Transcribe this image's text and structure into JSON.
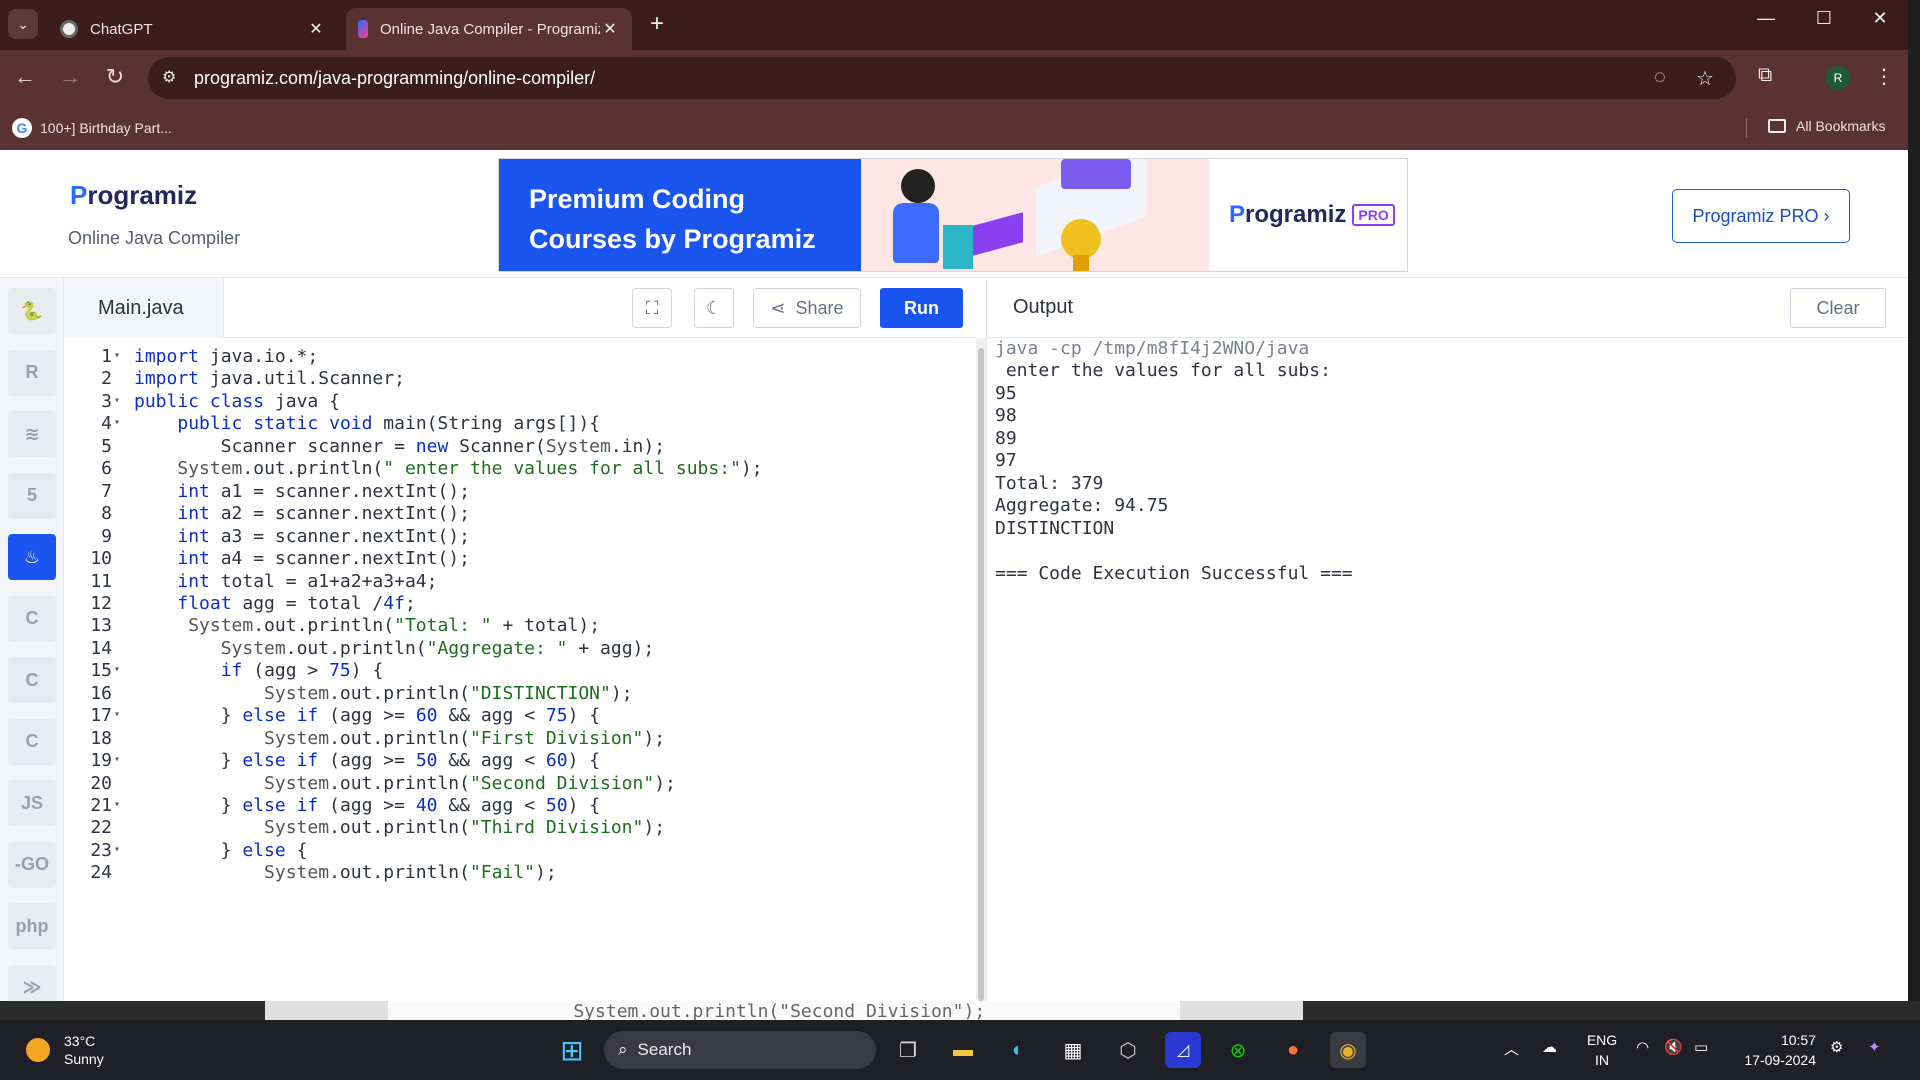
{
  "browser": {
    "tabs": [
      {
        "title": "ChatGPT",
        "active": false
      },
      {
        "title": "Online Java Compiler - Programiz",
        "active": true
      }
    ],
    "url": "programiz.com/java-programming/online-compiler/",
    "bookmarks": [
      {
        "label": "100+] Birthday Part..."
      }
    ],
    "all_bookmarks_label": "All Bookmarks",
    "profile_initial": "R"
  },
  "site": {
    "logo": "rogramiz",
    "logo_p": "P",
    "subtitle": "Online Java Compiler",
    "banner": {
      "headline_line1": "Premium Coding",
      "headline_line2": "Courses by Programiz",
      "brand": "rogramiz",
      "brand_p": "P",
      "pro_tag": "PRO"
    },
    "pro_button": "Programiz PRO ›"
  },
  "sidebar": {
    "languages": [
      {
        "name": "python",
        "glyph": "🐍",
        "active": false
      },
      {
        "name": "r",
        "glyph": "R",
        "active": false
      },
      {
        "name": "sql",
        "glyph": "≋",
        "active": false
      },
      {
        "name": "html",
        "glyph": "5",
        "active": false
      },
      {
        "name": "java",
        "glyph": "♨",
        "active": true
      },
      {
        "name": "c",
        "glyph": "C",
        "active": false
      },
      {
        "name": "cpp",
        "glyph": "C",
        "active": false
      },
      {
        "name": "csharp",
        "glyph": "C",
        "active": false
      },
      {
        "name": "javascript",
        "glyph": "JS",
        "active": false
      },
      {
        "name": "go",
        "glyph": "-GO",
        "active": false
      },
      {
        "name": "php",
        "glyph": "php",
        "active": false
      },
      {
        "name": "swift",
        "glyph": "≫",
        "active": false
      }
    ]
  },
  "editor": {
    "file_name": "Main.java",
    "share_label": "Share",
    "run_label": "Run",
    "lines": [
      {
        "n": "1",
        "fold": true,
        "text": "import java.io.*;"
      },
      {
        "n": "2",
        "fold": false,
        "text": "import java.util.Scanner;"
      },
      {
        "n": "3",
        "fold": true,
        "text": "public class java {"
      },
      {
        "n": "4",
        "fold": true,
        "text": "    public static void main(String args[]){"
      },
      {
        "n": "5",
        "fold": false,
        "text": "        Scanner scanner = new Scanner(System.in);"
      },
      {
        "n": "6",
        "fold": false,
        "text": "    System.out.println(\" enter the values for all subs:\");"
      },
      {
        "n": "7",
        "fold": false,
        "text": "    int a1 = scanner.nextInt();"
      },
      {
        "n": "8",
        "fold": false,
        "text": "    int a2 = scanner.nextInt();"
      },
      {
        "n": "9",
        "fold": false,
        "text": "    int a3 = scanner.nextInt();"
      },
      {
        "n": "10",
        "fold": false,
        "text": "    int a4 = scanner.nextInt();"
      },
      {
        "n": "11",
        "fold": false,
        "text": "    int total = a1+a2+a3+a4;"
      },
      {
        "n": "12",
        "fold": false,
        "text": "    float agg = total /4f;"
      },
      {
        "n": "13",
        "fold": false,
        "text": "     System.out.println(\"Total: \" + total);"
      },
      {
        "n": "14",
        "fold": false,
        "text": "        System.out.println(\"Aggregate: \" + agg);"
      },
      {
        "n": "15",
        "fold": true,
        "text": "        if (agg > 75) {"
      },
      {
        "n": "16",
        "fold": false,
        "text": "            System.out.println(\"DISTINCTION\");"
      },
      {
        "n": "17",
        "fold": true,
        "text": "        } else if (agg >= 60 && agg < 75) {"
      },
      {
        "n": "18",
        "fold": false,
        "text": "            System.out.println(\"First Division\");"
      },
      {
        "n": "19",
        "fold": true,
        "text": "        } else if (agg >= 50 && agg < 60) {"
      },
      {
        "n": "20",
        "fold": false,
        "text": "            System.out.println(\"Second Division\");"
      },
      {
        "n": "21",
        "fold": true,
        "text": "        } else if (agg >= 40 && agg < 50) {"
      },
      {
        "n": "22",
        "fold": false,
        "text": "            System.out.println(\"Third Division\");"
      },
      {
        "n": "23",
        "fold": true,
        "text": "        } else {"
      },
      {
        "n": "24",
        "fold": false,
        "text": "            System.out.println(\"Fail\");"
      }
    ]
  },
  "output": {
    "title": "Output",
    "clear_label": "Clear",
    "lines": [
      "java -cp /tmp/m8fI4j2WNO/java",
      " enter the values for all subs:",
      "95",
      "98",
      "89",
      "97",
      "Total: 379",
      "Aggregate: 94.75",
      "DISTINCTION",
      "",
      "=== Code Execution Successful ==="
    ]
  },
  "background_window": {
    "text": "    System.out.println(\"Second Division\");"
  },
  "taskbar": {
    "temperature": "33°C",
    "condition": "Sunny",
    "search_label": "Search",
    "language_line1": "ENG",
    "language_line2": "IN",
    "time": "10:57",
    "date": "17-09-2024"
  },
  "colors": {
    "accent": "#1a55ef",
    "chrome_frame": "#3b1d1e",
    "keyword": "#0a2fc7",
    "string": "#1c6f1c",
    "number": "#0a2fc7"
  }
}
